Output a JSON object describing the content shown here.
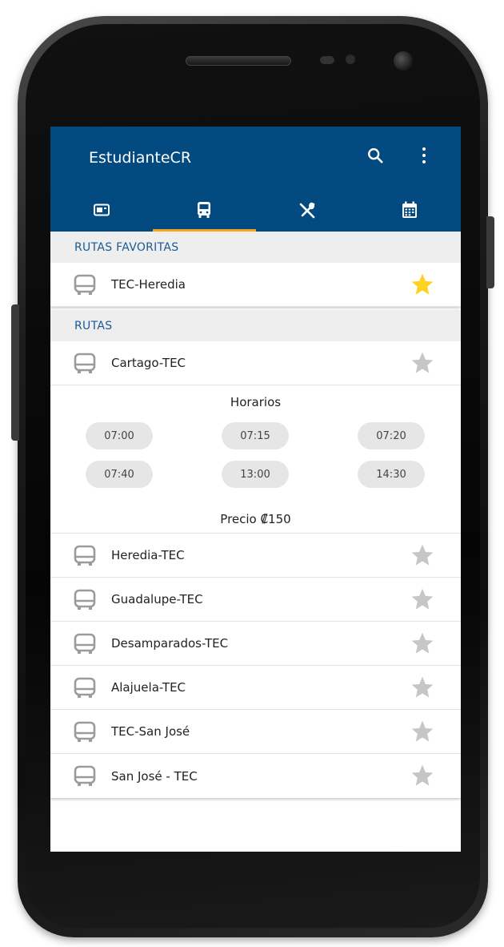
{
  "app": {
    "title": "EstudianteCR"
  },
  "toolbar": {
    "search_icon": "search-icon",
    "menu_icon": "more-vert-icon"
  },
  "tabs": [
    {
      "icon": "card-icon",
      "active": false
    },
    {
      "icon": "bus-icon",
      "active": true
    },
    {
      "icon": "restaurant-icon",
      "active": false
    },
    {
      "icon": "calendar-icon",
      "active": false
    }
  ],
  "favorites": {
    "header": "RUTAS FAVORITAS",
    "items": [
      {
        "name": "TEC-Heredia",
        "favorite": true
      }
    ]
  },
  "routes": {
    "header": "RUTAS",
    "expanded": {
      "name": "Cartago-TEC",
      "favorite": false,
      "schedule_title": "Horarios",
      "times": [
        "07:00",
        "07:15",
        "07:20",
        "07:40",
        "13:00",
        "14:30"
      ],
      "price": "Precio ₡150"
    },
    "items": [
      {
        "name": "Heredia-TEC",
        "favorite": false
      },
      {
        "name": "Guadalupe-TEC",
        "favorite": false
      },
      {
        "name": "Desamparados-TEC",
        "favorite": false
      },
      {
        "name": "Alajuela-TEC",
        "favorite": false
      },
      {
        "name": "TEC-San José",
        "favorite": false
      },
      {
        "name": "San José - TEC",
        "favorite": false
      }
    ]
  },
  "colors": {
    "appbar": "#024a80",
    "tab_indicator": "#f5a623",
    "star_active": "#ffd21f",
    "star_inactive": "#c6c6c6",
    "section_text": "#1a5a96"
  }
}
